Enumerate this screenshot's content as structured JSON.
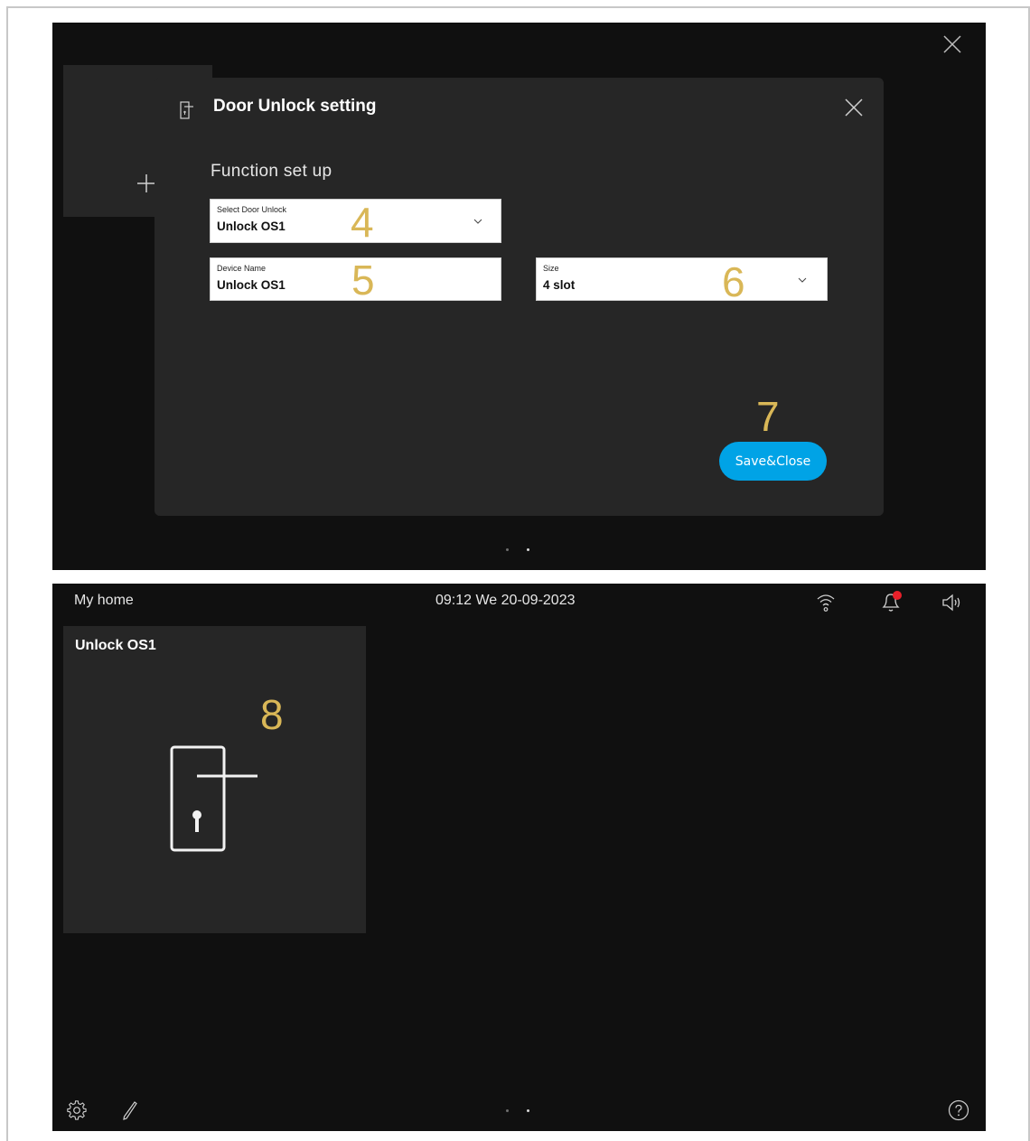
{
  "dialog": {
    "title": "Door Unlock setting",
    "section_title": "Function set up",
    "select_door_unlock": {
      "label": "Select Door Unlock",
      "value": "Unlock OS1"
    },
    "device_name": {
      "label": "Device Name",
      "value": "Unlock OS1"
    },
    "size": {
      "label": "Size",
      "value": "4 slot"
    },
    "save_close_label": "Save&Close"
  },
  "annotations": [
    "4",
    "5",
    "6",
    "7",
    "8"
  ],
  "status_bar": {
    "home_label": "My home",
    "datetime": "09:12  We 20-09-2023"
  },
  "tile": {
    "title": "Unlock OS1"
  },
  "icons": {
    "top_close": "close-icon",
    "add_tile": "plus-icon",
    "dialog_icon": "door-unlock-icon",
    "dialog_close": "close-icon",
    "dropdown": "chevron-down-icon",
    "wifi": "wifi-icon",
    "notifications": "bell-icon",
    "volume": "speaker-icon",
    "tile_icon": "door-handle-icon",
    "settings": "gear-icon",
    "edit": "pencil-icon",
    "help": "help-icon"
  },
  "colors": {
    "accent": "#00a3e6",
    "annotation": "#d9b757",
    "notification_dot": "#e8202a",
    "background": "#101010",
    "panel": "#262626"
  }
}
